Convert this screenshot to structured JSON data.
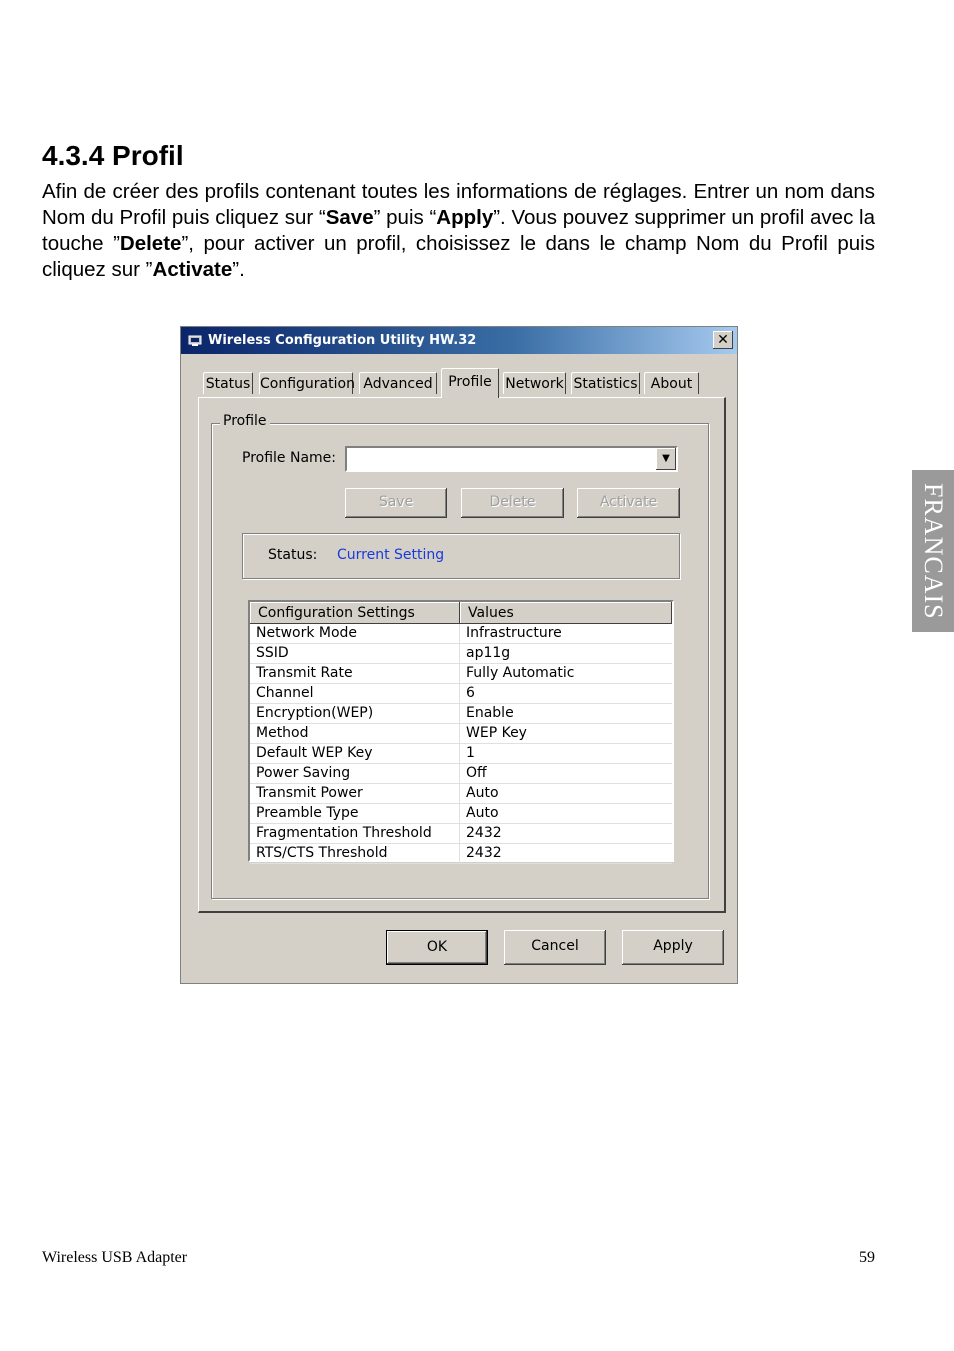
{
  "doc": {
    "heading": "4.3.4 Profil",
    "intro": [
      {
        "t": "Afin de créer des profils contenant toutes les informations de réglages. Entrer un nom dans Nom du Profil puis cliquez sur “"
      },
      {
        "t": "Save",
        "b": true
      },
      {
        "t": "” puis “"
      },
      {
        "t": "Apply",
        "b": true
      },
      {
        "t": "”. Vous pouvez supprimer un profil avec la touche ”"
      },
      {
        "t": "Delete",
        "b": true
      },
      {
        "t": "”, pour activer un profil, choisissez le dans le champ Nom du Profil puis cliquez sur ”"
      },
      {
        "t": "Activate",
        "b": true
      },
      {
        "t": "”."
      }
    ],
    "side_tab": "FRANCAIS",
    "footer_left": "Wireless USB Adapter",
    "page_number": "59"
  },
  "window": {
    "title": "Wireless Configuration Utility HW.32",
    "close_glyph": "✕",
    "tabs": [
      "Status",
      "Configuration",
      "Advanced",
      "Profile",
      "Network",
      "Statistics",
      "About"
    ],
    "active_tab": "Profile",
    "group_label": "Profile",
    "profile_name_label": "Profile Name:",
    "profile_name_value": "",
    "dropdown_glyph": "▼",
    "buttons": {
      "save": "Save",
      "delete": "Delete",
      "activate": "Activate"
    },
    "status_label": "Status:",
    "status_value": "Current Setting",
    "status_color": "#1a3ad8",
    "table": {
      "headers": [
        "Configuration Settings",
        "Values"
      ],
      "rows": [
        [
          "Network Mode",
          "Infrastructure"
        ],
        [
          "SSID",
          "ap11g"
        ],
        [
          "Transmit Rate",
          "Fully Automatic"
        ],
        [
          "Channel",
          "6"
        ],
        [
          "Encryption(WEP)",
          "Enable"
        ],
        [
          "Method",
          "WEP Key"
        ],
        [
          "Default WEP Key",
          "1"
        ],
        [
          "Power Saving",
          "Off"
        ],
        [
          "Transmit Power",
          "Auto"
        ],
        [
          "Preamble Type",
          "Auto"
        ],
        [
          "Fragmentation Threshold",
          "2432"
        ],
        [
          "RTS/CTS Threshold",
          "2432"
        ]
      ]
    },
    "footer_buttons": {
      "ok": "OK",
      "cancel": "Cancel",
      "apply": "Apply"
    }
  }
}
